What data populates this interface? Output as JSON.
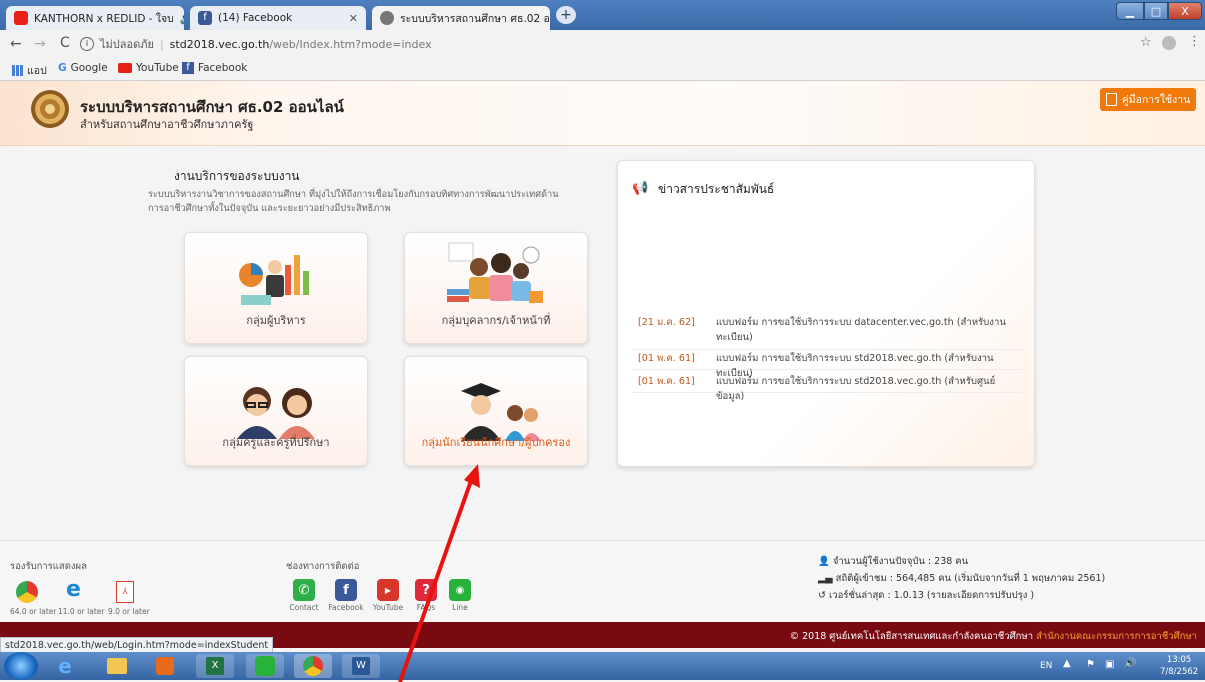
{
  "tabs": [
    {
      "title": "KANTHORN x REDLID - ใจบ",
      "favicon_color": "#e62117",
      "active": false
    },
    {
      "title": "(14) Facebook",
      "favicon_color": "#3b5998",
      "active": false
    },
    {
      "title": "ระบบบริหารสถานศึกษา ศธ.02 ออน",
      "favicon_color": "#666666",
      "active": true
    }
  ],
  "window_controls": {
    "minimize": "▁",
    "maximize": "□",
    "close": "X"
  },
  "address": {
    "security": "ไม่ปลอดภัย",
    "host": "std2018.vec.go.th",
    "path": "/web/Index.htm?mode=index"
  },
  "bookmarks": [
    {
      "label": "แอป",
      "color": "#4a7fd6"
    },
    {
      "label": "Google",
      "color": "#4285f4"
    },
    {
      "label": "YouTube",
      "color": "#e62117"
    },
    {
      "label": "Facebook",
      "color": "#3b5998"
    }
  ],
  "site": {
    "title": "ระบบบริหารสถานศึกษา ศธ.02 ออนไลน์",
    "subtitle": "สำหรับสถานศึกษาอาชีวศึกษาภาครัฐ",
    "manual_button": "คู่มือการใช้งาน",
    "accent": "#f0790a"
  },
  "services": {
    "heading": "งานบริการของระบบงาน",
    "description_line1": "ระบบบริหารงานวิชาการของสถานศึกษา ที่มุ่งไปให้ถึงการเชื่อมโยงกับกรอบทิศทางการพัฒนาประเทศด้าน",
    "description_line2": "การอาชีวศึกษาทั้งในปัจจุบัน และระยะยาวอย่างมีประสิทธิภาพ",
    "cards": [
      {
        "label": "กลุ่มผู้บริหาร"
      },
      {
        "label": "กลุ่มบุคลากร/เจ้าหน้าที่"
      },
      {
        "label": "กลุ่มครูและครูที่ปรึกษา"
      },
      {
        "label": "กลุ่มนักเรียนนักศึกษา/ผู้ปกครอง"
      }
    ]
  },
  "news": {
    "heading": "ข่าวสารประชาสัมพันธ์",
    "items": [
      {
        "date": "[21 ม.ค. 62]",
        "text": "แบบฟอร์ม การขอใช้บริการระบบ datacenter.vec.go.th (สำหรับงานทะเบียน)"
      },
      {
        "date": "[01 พ.ค. 61]",
        "text": "แบบฟอร์ม การขอใช้บริการระบบ std2018.vec.go.th (สำหรับงานทะเบียน)"
      },
      {
        "date": "[01 พ.ค. 61]",
        "text": "แบบฟอร์ม การขอใช้บริการระบบ std2018.vec.go.th (สำหรับศูนย์ข้อมูล)"
      }
    ]
  },
  "footer": {
    "support_heading": "รองรับการแสดงผล",
    "browsers": [
      {
        "label": "64.0 or later",
        "color": "#e8a21b"
      },
      {
        "label": "11.0 or later",
        "color": "#1e88d3"
      },
      {
        "label": "9.0 or later",
        "color": "#d93f2a"
      }
    ],
    "contact_heading": "ช่องทางการติดต่อ",
    "contacts": [
      {
        "label": "Contact",
        "color": "#2eaf4a"
      },
      {
        "label": "Facebook",
        "color": "#3b5998"
      },
      {
        "label": "YouTube",
        "color": "#d9362b"
      },
      {
        "label": "FAQs",
        "color": "#e0293b"
      },
      {
        "label": "Line",
        "color": "#27b33b"
      }
    ],
    "stats": {
      "current_users": "จำนวนผู้ใช้งานปัจจุบัน : 238 คน",
      "visits": "สถิติผู้เข้าชม : 564,485 คน (เริ่มนับจากวันที่ 1 พฤษภาคม 2561)",
      "version": "เวอร์ชั่นล่าสุด : 1.0.13 (รายละเอียดการปรับปรุง )"
    },
    "copyright_prefix": "© 2018 ศูนย์เทคโนโลยีสารสนเทศและกำลังคนอาชีวศึกษา",
    "copyright_org": "สำนักงานคณะกรรมการการอาชีวศึกษา"
  },
  "status_url": "std2018.vec.go.th/web/Login.htm?mode=indexStudent",
  "taskbar": {
    "lang": "EN",
    "time": "13:05",
    "date": "7/8/2562"
  }
}
